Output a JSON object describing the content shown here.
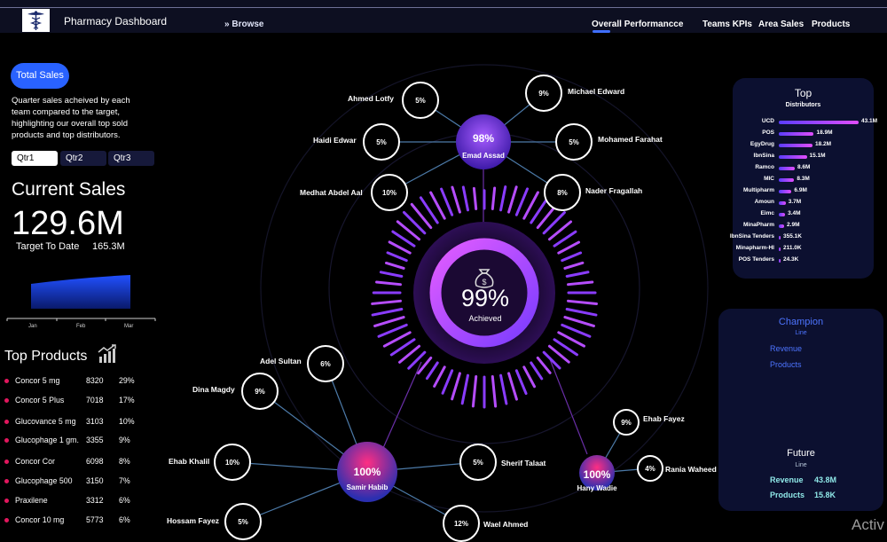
{
  "header": {
    "title": "Pharmacy Dashboard",
    "browse": "Browse",
    "nav": [
      "Overall Performancce",
      "Teams KPIs",
      "Area Sales",
      "Products"
    ]
  },
  "left": {
    "button": "Total Sales",
    "description": "Quarter sales  acheived by each team compared to the target, highlighting our overall top sold products and top distributors.",
    "quarters": [
      "Qtr1",
      "Qtr2",
      "Qtr3"
    ],
    "current_sales_label": "Current Sales",
    "current_sales_value": "129.6M",
    "target_label": "Target To Date",
    "target_value": "165.3M",
    "months": [
      "Jan",
      "Feb",
      "Mar"
    ],
    "top_products_title": "Top Products",
    "products": [
      {
        "name": "Concor 5 mg",
        "qty": "8320",
        "pct": "29%"
      },
      {
        "name": "Concor 5 Plus",
        "qty": "7018",
        "pct": "17%"
      },
      {
        "name": "Glucovance 5 mg",
        "qty": "3103",
        "pct": "10%"
      },
      {
        "name": "Glucophage 1 gm.",
        "qty": "3355",
        "pct": "9%"
      },
      {
        "name": "Concor Cor",
        "qty": "6098",
        "pct": "8%"
      },
      {
        "name": "Glucophage 500",
        "qty": "3150",
        "pct": "7%"
      },
      {
        "name": "Praxilene",
        "qty": "3312",
        "pct": "6%"
      },
      {
        "name": "Concor 10 mg",
        "qty": "5773",
        "pct": "6%"
      }
    ]
  },
  "center": {
    "achieved_pct": "99%",
    "achieved_label": "Achieved",
    "hubs": [
      {
        "name": "Emad Assad",
        "pct": "98%"
      },
      {
        "name": "Samir Habib",
        "pct": "100%"
      },
      {
        "name": "Hany Wadie",
        "pct": "100%"
      }
    ],
    "members": [
      {
        "name": "Ahmed Lotfy",
        "pct": "5%"
      },
      {
        "name": "Michael Edward",
        "pct": "9%"
      },
      {
        "name": "Haidi Edwar",
        "pct": "5%"
      },
      {
        "name": "Mohamed Farahat",
        "pct": "5%"
      },
      {
        "name": "Medhat Abdel Aal",
        "pct": "10%"
      },
      {
        "name": "Nader Fragallah",
        "pct": "8%"
      },
      {
        "name": "Adel Sultan",
        "pct": "6%"
      },
      {
        "name": "Dina Magdy",
        "pct": "9%"
      },
      {
        "name": "Ehab Khalil",
        "pct": "10%"
      },
      {
        "name": "Sherif Talaat",
        "pct": "5%"
      },
      {
        "name": "Hossam Fayez",
        "pct": "5%"
      },
      {
        "name": "Wael Ahmed",
        "pct": "12%"
      },
      {
        "name": "Ehab Fayez",
        "pct": "9%"
      },
      {
        "name": "Rania Waheed",
        "pct": "4%"
      }
    ]
  },
  "distributors": {
    "title": "Top",
    "subtitle": "Distributors",
    "items": [
      {
        "name": "UCD",
        "value": "43.1M",
        "amount": 43.1
      },
      {
        "name": "POS",
        "value": "18.9M",
        "amount": 18.9
      },
      {
        "name": "EgyDrug",
        "value": "18.2M",
        "amount": 18.2
      },
      {
        "name": "IbnSina",
        "value": "15.1M",
        "amount": 15.1
      },
      {
        "name": "Ramco",
        "value": "8.6M",
        "amount": 8.6
      },
      {
        "name": "MIC",
        "value": "8.3M",
        "amount": 8.3
      },
      {
        "name": "Multipharm",
        "value": "6.9M",
        "amount": 6.9
      },
      {
        "name": "Amoun",
        "value": "3.7M",
        "amount": 3.7
      },
      {
        "name": "Eimc",
        "value": "3.4M",
        "amount": 3.4
      },
      {
        "name": "MinaPharm",
        "value": "2.9M",
        "amount": 2.9
      },
      {
        "name": "IbnSina Tenders",
        "value": "355.1K",
        "amount": 0.3551
      },
      {
        "name": "Minapharm-HI",
        "value": "211.0K",
        "amount": 0.211
      },
      {
        "name": "POS Tenders",
        "value": "24.3K",
        "amount": 0.0243
      }
    ]
  },
  "champion": {
    "title": "Champion",
    "subtitle": "Line",
    "items": [
      "Revenue",
      "Products"
    ],
    "future_title": "Future",
    "future_subtitle": "Line",
    "future_revenue_label": "Revenue",
    "future_revenue_value": "43.8M",
    "future_products_label": "Products",
    "future_products_value": "15.8K"
  },
  "watermark": "Activ",
  "colors": {
    "accent": "#2962ff",
    "magenta": "#e3175e",
    "purple": "#a64dff",
    "panel": "#0c1030"
  }
}
